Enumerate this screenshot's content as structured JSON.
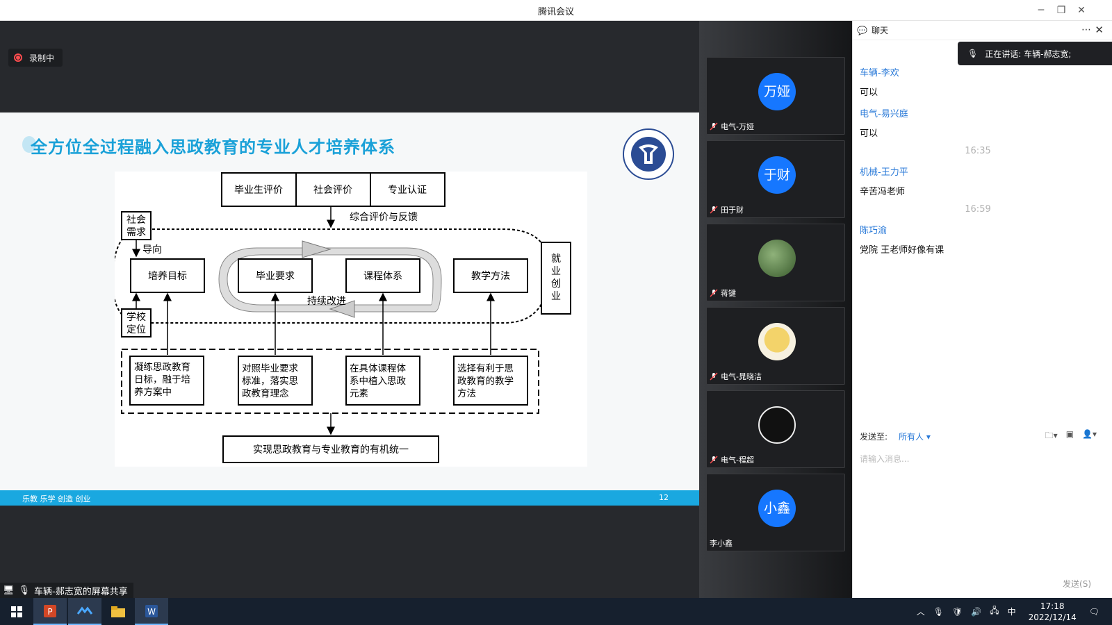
{
  "window": {
    "title": "腾讯会议"
  },
  "recording": {
    "label": "录制中"
  },
  "slide": {
    "title": "全方位全过程融入思政教育的专业人才培养体系",
    "footer_motto": "乐教 乐学 创造 创业",
    "page_number": "12",
    "diagram": {
      "top_boxes": [
        "毕业生评价",
        "社会评价",
        "专业认证"
      ],
      "feedback_label": "综合评价与反馈",
      "social_need": [
        "社会",
        "需求"
      ],
      "guide_label": "导向",
      "school_position": [
        "学校",
        "定位"
      ],
      "middle_boxes": [
        "培养目标",
        "毕业要求",
        "课程体系",
        "教学方法"
      ],
      "improve_label": "持续改进",
      "employment": [
        "就",
        "业",
        "创",
        "业"
      ],
      "bottom_boxes": [
        [
          "凝练思政教育",
          "日标，融于培",
          "养方案中"
        ],
        [
          "对照毕业要求",
          "标准，落实思",
          "政教育理念"
        ],
        [
          "在具体课程体",
          "系中植入思政",
          "元素"
        ],
        [
          "选择有利于思",
          "政教育的教学",
          "方法"
        ]
      ],
      "result_box": "实现思政教育与专业教育的有机统一"
    }
  },
  "sharer": {
    "label": "车辆-郝志宽的屏幕共享"
  },
  "participants": [
    {
      "avatar_text": "万娅",
      "name": "电气-万娅",
      "avatar_type": "text"
    },
    {
      "avatar_text": "于财",
      "name": "田于财",
      "avatar_type": "text"
    },
    {
      "avatar_text": "",
      "name": "蒋键",
      "avatar_type": "image-lotus"
    },
    {
      "avatar_text": "",
      "name": "电气-晁晓洁",
      "avatar_type": "image-cartoon"
    },
    {
      "avatar_text": "",
      "name": "电气-程超",
      "avatar_type": "image-nike"
    },
    {
      "avatar_text": "小鑫",
      "name": "李小鑫",
      "avatar_type": "text"
    }
  ],
  "chat": {
    "title": "聊天",
    "speaking": "正在讲话: 车辆-郝志宽;",
    "messages": [
      {
        "type": "sender",
        "text": "车辆-李欢"
      },
      {
        "type": "text",
        "text": "可以"
      },
      {
        "type": "sender",
        "text": "电气-易兴庭"
      },
      {
        "type": "text",
        "text": "可以"
      },
      {
        "type": "time",
        "text": "16:35"
      },
      {
        "type": "sender",
        "text": "机械-王力平"
      },
      {
        "type": "text",
        "text": "辛苦冯老师"
      },
      {
        "type": "time",
        "text": "16:59"
      },
      {
        "type": "sender",
        "text": "陈巧渝"
      },
      {
        "type": "text",
        "text": "党院 王老师好像有课"
      }
    ],
    "send_to_label": "发送至:",
    "send_to_value": "所有人",
    "input_placeholder": "请输入消息...",
    "send_button": "发送(S)"
  },
  "taskbar": {
    "time": "17:18",
    "date": "2022/12/14",
    "ime": "中",
    "apps": [
      "start-icon",
      "powerpoint-icon",
      "tencent-meeting-icon",
      "file-explorer-icon",
      "word-icon"
    ]
  },
  "colors": {
    "accent": "#1aa8e0",
    "avatar_blue": "#1677ff",
    "link_blue": "#2a7ad8"
  }
}
